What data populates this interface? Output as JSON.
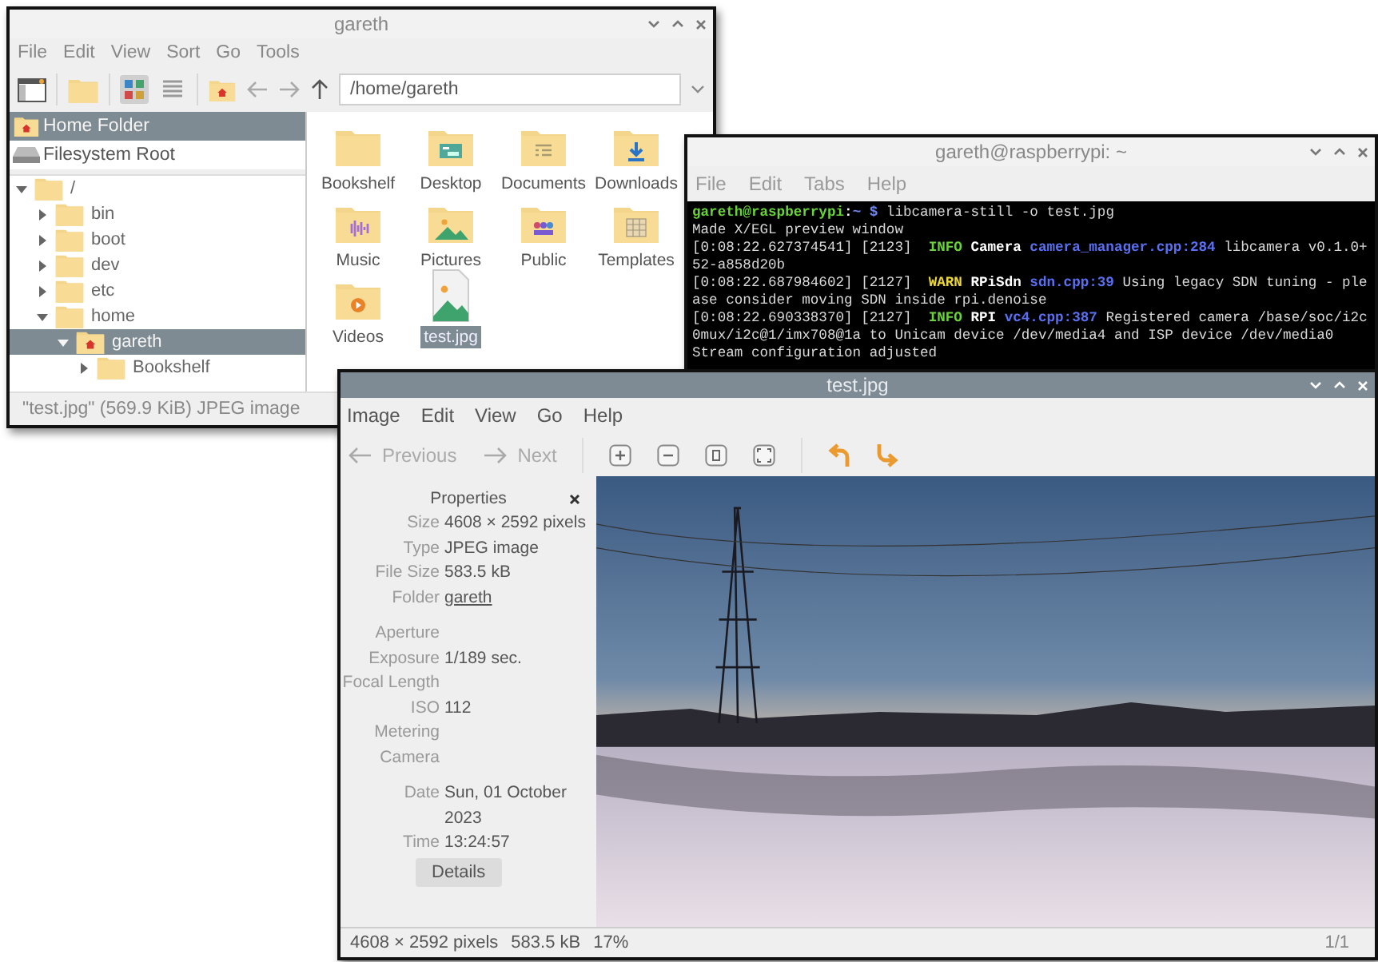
{
  "file_manager": {
    "title": "gareth",
    "active": false,
    "menu": [
      "File",
      "Edit",
      "View",
      "Sort",
      "Go",
      "Tools"
    ],
    "views": [
      {
        "kind": "icons",
        "selected": true
      },
      {
        "kind": "list",
        "selected": false
      }
    ],
    "path": "/home/gareth",
    "places": [
      {
        "label": "Home Folder",
        "kind": "home",
        "selected": true
      },
      {
        "label": "Filesystem Root",
        "kind": "drive",
        "selected": false
      }
    ],
    "tree": [
      {
        "label": "/",
        "kind": "folder",
        "expanded": true,
        "selected": false,
        "children": [
          {
            "label": "bin",
            "kind": "folder",
            "expanded": false,
            "selected": false
          },
          {
            "label": "boot",
            "kind": "folder",
            "expanded": false,
            "selected": false
          },
          {
            "label": "dev",
            "kind": "folder",
            "expanded": false,
            "selected": false
          },
          {
            "label": "etc",
            "kind": "folder",
            "expanded": false,
            "selected": false
          },
          {
            "label": "home",
            "kind": "folder",
            "expanded": true,
            "selected": false,
            "children": [
              {
                "label": "gareth",
                "kind": "home",
                "expanded": true,
                "selected": true,
                "children": [
                  {
                    "label": "Bookshelf",
                    "kind": "folder",
                    "expanded": false,
                    "selected": false
                  }
                ]
              }
            ]
          }
        ]
      }
    ],
    "files": [
      {
        "name": "Bookshelf",
        "kind": "plain",
        "selected": false
      },
      {
        "name": "Desktop",
        "kind": "desktop",
        "selected": false
      },
      {
        "name": "Documents",
        "kind": "documents",
        "selected": false
      },
      {
        "name": "Downloads",
        "kind": "downloads",
        "selected": false
      },
      {
        "name": "Music",
        "kind": "music",
        "selected": false
      },
      {
        "name": "Pictures",
        "kind": "pictures",
        "selected": false
      },
      {
        "name": "Public",
        "kind": "public",
        "selected": false
      },
      {
        "name": "Templates",
        "kind": "templates",
        "selected": false
      },
      {
        "name": "Videos",
        "kind": "videos",
        "selected": false
      },
      {
        "name": "test.jpg",
        "kind": "image",
        "selected": true
      }
    ],
    "status": "\"test.jpg\" (569.9 KiB) JPEG image"
  },
  "terminal": {
    "title": "gareth@raspberrypi: ~",
    "active": false,
    "menu": [
      "File",
      "Edit",
      "Tabs",
      "Help"
    ],
    "lines": [
      [
        {
          "kind": "prompt",
          "text": "gareth@raspberrypi"
        },
        {
          "kind": "name",
          "text": ":"
        },
        {
          "kind": "path",
          "text": "~ $"
        },
        {
          "kind": "plain",
          "text": " libcamera-still -o test.jpg"
        }
      ],
      [
        {
          "kind": "plain",
          "text": "Made X/EGL preview window"
        }
      ],
      [
        {
          "kind": "plain",
          "text": "[0:08:22.627374541] [2123]  "
        },
        {
          "kind": "info",
          "text": "INFO"
        },
        {
          "kind": "name",
          "text": " Camera "
        },
        {
          "kind": "file",
          "text": "camera_manager.cpp:284"
        },
        {
          "kind": "plain",
          "text": " libcamera v0.1.0+"
        }
      ],
      [
        {
          "kind": "plain",
          "text": "52-a858d20b"
        }
      ],
      [
        {
          "kind": "plain",
          "text": "[0:08:22.687984602] [2127]  "
        },
        {
          "kind": "warn",
          "text": "WARN"
        },
        {
          "kind": "name",
          "text": " RPiSdn "
        },
        {
          "kind": "file",
          "text": "sdn.cpp:39"
        },
        {
          "kind": "plain",
          "text": " Using legacy SDN tuning - ple"
        }
      ],
      [
        {
          "kind": "plain",
          "text": "ase consider moving SDN inside rpi.denoise"
        }
      ],
      [
        {
          "kind": "plain",
          "text": "[0:08:22.690338370] [2127]  "
        },
        {
          "kind": "info",
          "text": "INFO"
        },
        {
          "kind": "name",
          "text": " RPI "
        },
        {
          "kind": "file",
          "text": "vc4.cpp:387"
        },
        {
          "kind": "plain",
          "text": " Registered camera /base/soc/i2c"
        }
      ],
      [
        {
          "kind": "plain",
          "text": "0mux/i2c@1/imx708@1a to Unicam device /dev/media4 and ISP device /dev/media0"
        }
      ],
      [
        {
          "kind": "plain",
          "text": "Stream configuration adjusted"
        }
      ]
    ]
  },
  "image_viewer": {
    "title": "test.jpg",
    "active": true,
    "menu": [
      "Image",
      "Edit",
      "View",
      "Go",
      "Help"
    ],
    "nav": [
      {
        "label": "Previous",
        "kind": "back",
        "disabled": true
      },
      {
        "label": "Next",
        "kind": "forward",
        "disabled": true
      }
    ],
    "properties": {
      "title": "Properties",
      "groups": [
        {
          "rows": [
            {
              "label": "Size",
              "value": "4608 × 2592 pixels",
              "kind": "text"
            },
            {
              "label": "Type",
              "value": "JPEG image",
              "kind": "text"
            },
            {
              "label": "File Size",
              "value": "583.5 kB",
              "kind": "text"
            },
            {
              "label": "Folder",
              "value": "gareth",
              "kind": "link"
            }
          ]
        },
        {
          "rows": [
            {
              "label": "Aperture"
            },
            {
              "label": "Exposure",
              "value": "1/189 sec.",
              "kind": "text"
            },
            {
              "label": "Focal Length"
            },
            {
              "label": "ISO",
              "value": "112",
              "kind": "text"
            },
            {
              "label": "Metering"
            },
            {
              "label": "Camera"
            }
          ]
        },
        {
          "rows": [
            {
              "label": "Date",
              "value": "Sun, 01 October 2023",
              "kind": "text"
            },
            {
              "label": "Time",
              "value": "13:24:57",
              "kind": "text"
            }
          ]
        }
      ],
      "button": "Details"
    },
    "status": {
      "dimensions": "4608 × 2592 pixels",
      "size": "583.5 kB",
      "zoom": "17%",
      "page": "1/1"
    }
  }
}
